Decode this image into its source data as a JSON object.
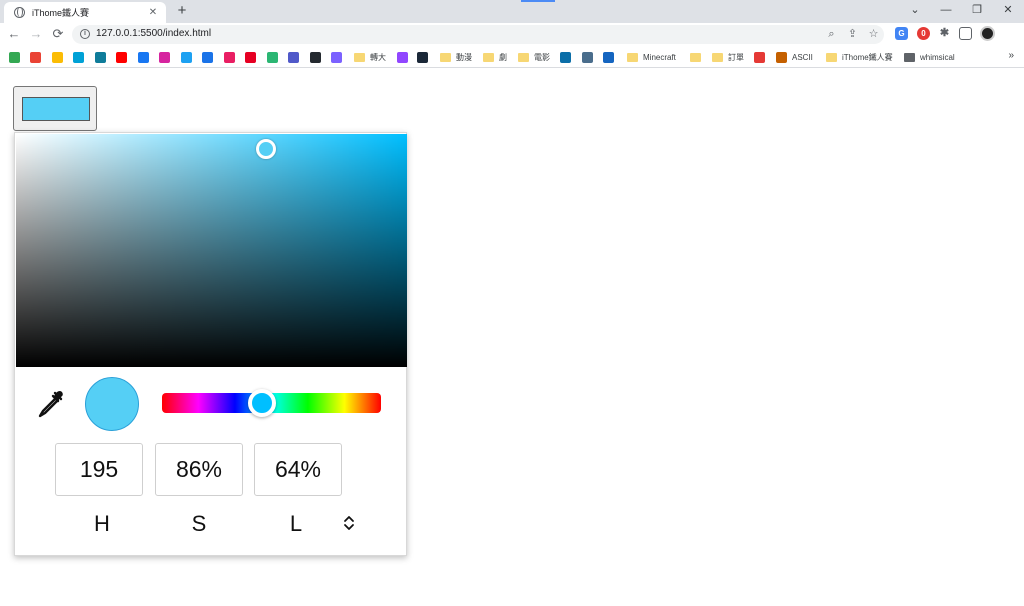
{
  "browser": {
    "tab_title": "iThome鐵人賽",
    "tab_close": "✕",
    "new_tab": "+",
    "url": "127.0.0.1:5500/index.html",
    "window_controls": [
      "⌄",
      "—",
      "❐",
      "✕"
    ],
    "nav": {
      "back": "←",
      "forward": "→",
      "reload": "⟳"
    }
  },
  "bookmarks": [
    {
      "label": "",
      "type": "icon",
      "color": "#34a853"
    },
    {
      "label": "",
      "type": "icon",
      "color": "#ea4335"
    },
    {
      "label": "",
      "type": "icon",
      "color": "#fbbc05"
    },
    {
      "label": "",
      "type": "icon",
      "color": "#00a1d6"
    },
    {
      "label": "",
      "type": "icon",
      "color": "#0f7c9a"
    },
    {
      "label": "",
      "type": "icon",
      "color": "#ff0000"
    },
    {
      "label": "",
      "type": "icon",
      "color": "#1877f2"
    },
    {
      "label": "",
      "type": "icon",
      "color": "#d6249f"
    },
    {
      "label": "",
      "type": "icon",
      "color": "#1da1f2"
    },
    {
      "label": "",
      "type": "icon",
      "color": "#1a73e8"
    },
    {
      "label": "",
      "type": "icon",
      "color": "#e91e63"
    },
    {
      "label": "",
      "type": "icon",
      "color": "#e60023"
    },
    {
      "label": "",
      "type": "icon",
      "color": "#2bb673"
    },
    {
      "label": "",
      "type": "icon",
      "color": "#5059c9"
    },
    {
      "label": "",
      "type": "icon",
      "color": "#24292f"
    },
    {
      "label": "",
      "type": "icon",
      "color": "#7b61ff"
    },
    {
      "label": "轉大",
      "type": "folder"
    },
    {
      "label": "",
      "type": "icon",
      "color": "#9146ff"
    },
    {
      "label": "",
      "type": "icon",
      "color": "#1b2838"
    },
    {
      "label": "動漫",
      "type": "folder"
    },
    {
      "label": "劇",
      "type": "folder"
    },
    {
      "label": "電影",
      "type": "folder"
    },
    {
      "label": "",
      "type": "icon",
      "color": "#0b6ea8"
    },
    {
      "label": "",
      "type": "icon",
      "color": "#4a6d8c"
    },
    {
      "label": "",
      "type": "icon",
      "color": "#1565c0"
    },
    {
      "label": "Minecraft",
      "type": "folder"
    },
    {
      "label": "",
      "type": "folder"
    },
    {
      "label": "訂單",
      "type": "folder"
    },
    {
      "label": "",
      "type": "icon",
      "color": "#e53935"
    },
    {
      "label": "ASCII",
      "type": "icon",
      "color": "#c56000"
    },
    {
      "label": "iThome鐵人賽",
      "type": "folder"
    },
    {
      "label": "whimsical",
      "type": "folder-dark"
    }
  ],
  "bookmarks_more": "»",
  "color": {
    "h": 195,
    "s": 86,
    "l": 64,
    "hex": "#55cff5",
    "pure_hue": "#00bfff"
  },
  "fields": [
    {
      "value": "195",
      "label": "H"
    },
    {
      "value": "86%",
      "label": "S"
    },
    {
      "value": "64%",
      "label": "L"
    }
  ]
}
